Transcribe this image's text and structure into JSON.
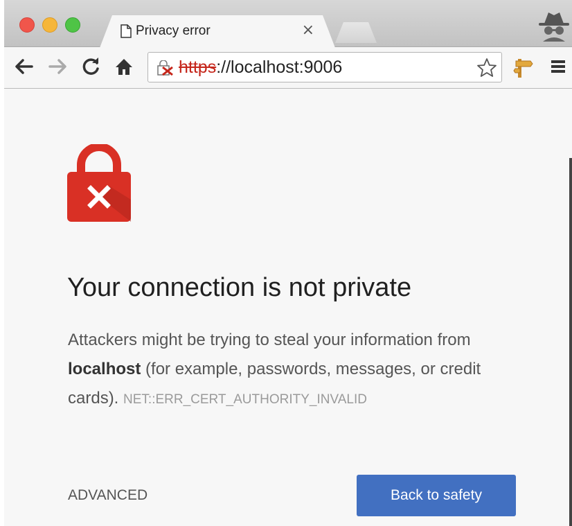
{
  "tab": {
    "title": "Privacy error",
    "close": "×"
  },
  "address_bar": {
    "url_scheme": "https",
    "url_rest": "://localhost:9006"
  },
  "interstitial": {
    "heading": "Your connection is not private",
    "explanation_before": "Attackers might be trying to steal your information from",
    "host": "localhost",
    "explanation_after": " (for example, passwords, messages, or credit cards).",
    "error_code": "NET::ERR_CERT_AUTHORITY_INVALID",
    "advanced_label": "ADVANCED",
    "primary_button_label": "Back to safety"
  },
  "colors": {
    "error_red": "#d93025",
    "primary_blue": "#4270c1",
    "url_scheme_red": "#c5261b"
  },
  "icons": {
    "window_controls": [
      "close-dot",
      "minimize-dot",
      "zoom-dot"
    ],
    "tab_icon": "page-icon",
    "incognito": "incognito-spy-icon",
    "toolbar": [
      "back-arrow",
      "forward-arrow",
      "reload",
      "home"
    ],
    "omnibox_left": "broken-lock-icon",
    "omnibox_right": "star-icon",
    "extension": "signpost-icon",
    "menu": "hamburger-icon",
    "page_hero": "red-padlock-x-icon"
  }
}
